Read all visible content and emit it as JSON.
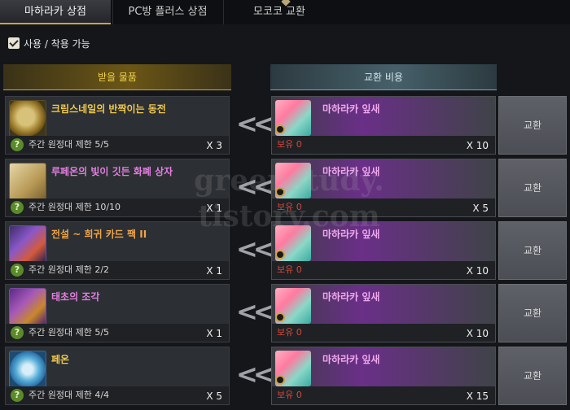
{
  "tabs": [
    {
      "label": "마하라카 상점"
    },
    {
      "label": "PC방 플러스 상점"
    },
    {
      "label": "모코코 교환"
    }
  ],
  "filter": {
    "label": "사용 / 착용 가능",
    "checked": true
  },
  "headers": {
    "receive": "받을 물품",
    "cost": "교환 비용"
  },
  "rows": [
    {
      "name": "크림스네일의 반짝이는 동전",
      "icon": "coin-icon",
      "limit": "주간 원정대 제한 5/5",
      "qty": "X 3",
      "cost_name": "마하라카 잎새",
      "cost_hold": "보유 0",
      "cost_qty": "X 10",
      "button": "교환"
    },
    {
      "name": "루페온의 빛이 깃든 화폐 상자",
      "icon": "chest-icon",
      "limit": "주간 원정대 제한 10/10",
      "qty": "X 1",
      "cost_name": "마하라카 잎새",
      "cost_hold": "보유 0",
      "cost_qty": "X 5",
      "button": "교환"
    },
    {
      "name": "전설 ~ 희귀 카드 팩 II",
      "icon": "card-pack-icon",
      "limit": "주간 원정대 제한 2/2",
      "qty": "X 1",
      "cost_name": "마하라카 잎새",
      "cost_hold": "보유 0",
      "cost_qty": "X 10",
      "button": "교환"
    },
    {
      "name": "태초의 조각",
      "icon": "fragment-icon",
      "limit": "주간 원정대 제한 5/5",
      "qty": "X 1",
      "cost_name": "마하라카 잎새",
      "cost_hold": "보유 0",
      "cost_qty": "X 10",
      "button": "교환"
    },
    {
      "name": "페온",
      "icon": "peon-icon",
      "limit": "주간 원정대 제한 4/4",
      "qty": "X 5",
      "cost_name": "마하라카 잎새",
      "cost_hold": "보유 0",
      "cost_qty": "X 15",
      "button": "교환"
    }
  ],
  "watermark": [
    "greenstudy.",
    "tistory.com"
  ],
  "colors": {
    "accent_gold": "#c9a44a",
    "name_gold": "#f2c94c",
    "name_purple": "#e27ee0",
    "hold_red": "#d84a3a"
  }
}
